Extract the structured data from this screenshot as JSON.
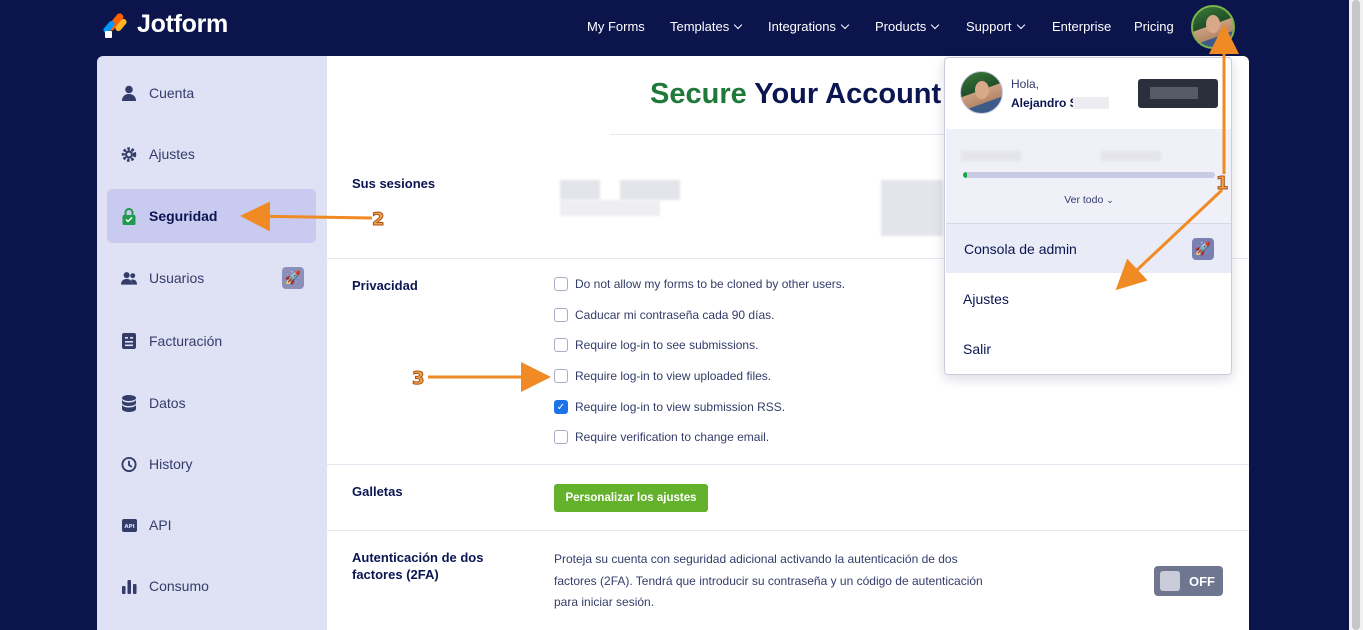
{
  "brand": {
    "name": "Jotform"
  },
  "nav": {
    "items": [
      {
        "label": "My Forms"
      },
      {
        "label": "Templates"
      },
      {
        "label": "Integrations"
      },
      {
        "label": "Products"
      },
      {
        "label": "Support"
      },
      {
        "label": "Enterprise"
      },
      {
        "label": "Pricing"
      }
    ]
  },
  "sidebar": {
    "items": [
      {
        "label": "Cuenta",
        "icon": "user-icon"
      },
      {
        "label": "Ajustes",
        "icon": "gear-icon"
      },
      {
        "label": "Seguridad",
        "icon": "lock-icon"
      },
      {
        "label": "Usuarios",
        "icon": "users-icon"
      },
      {
        "label": "Facturación",
        "icon": "invoice-icon"
      },
      {
        "label": "Datos",
        "icon": "database-icon"
      },
      {
        "label": "History",
        "icon": "history-icon"
      },
      {
        "label": "API",
        "icon": "api-icon"
      },
      {
        "label": "Consumo",
        "icon": "bar-chart-icon"
      }
    ]
  },
  "main": {
    "title_accent": "Secure",
    "title_rest": " Your Account",
    "sections": {
      "sessions": {
        "label": "Sus sesiones"
      },
      "privacy": {
        "label": "Privacidad",
        "options": [
          {
            "label": "Do not allow my forms to be cloned by other users.",
            "checked": false
          },
          {
            "label": "Caducar mi contraseña cada 90 días.",
            "checked": false
          },
          {
            "label": "Require log-in to see submissions.",
            "checked": false
          },
          {
            "label": "Require log-in to view uploaded files.",
            "checked": false
          },
          {
            "label": "Require log-in to view submission RSS.",
            "checked": true
          },
          {
            "label": "Require verification to change email.",
            "checked": false
          }
        ]
      },
      "cookies": {
        "label": "Galletas",
        "button": "Personalizar los ajustes"
      },
      "twofa": {
        "label_line1": "Autenticación de dos",
        "label_line2": "factores (2FA)",
        "text": "Proteja su cuenta con seguridad adicional activando la autenticación de dos factores (2FA). Tendrá que introducir su contraseña y un código de autenticación para iniciar sesión.",
        "toggle": "OFF"
      }
    }
  },
  "dropdown": {
    "greeting": "Hola,",
    "name": "Alejandro S",
    "usage_fraction": 0.01,
    "view_all": "Ver todo",
    "admin_console": "Consola de admin",
    "settings": "Ajustes",
    "logout": "Salir"
  },
  "annotations": [
    "1",
    "2",
    "3"
  ],
  "colors": {
    "nav_bg": "#0b154c",
    "accent_green": "#64b22c",
    "arrow": "#f08a24"
  }
}
